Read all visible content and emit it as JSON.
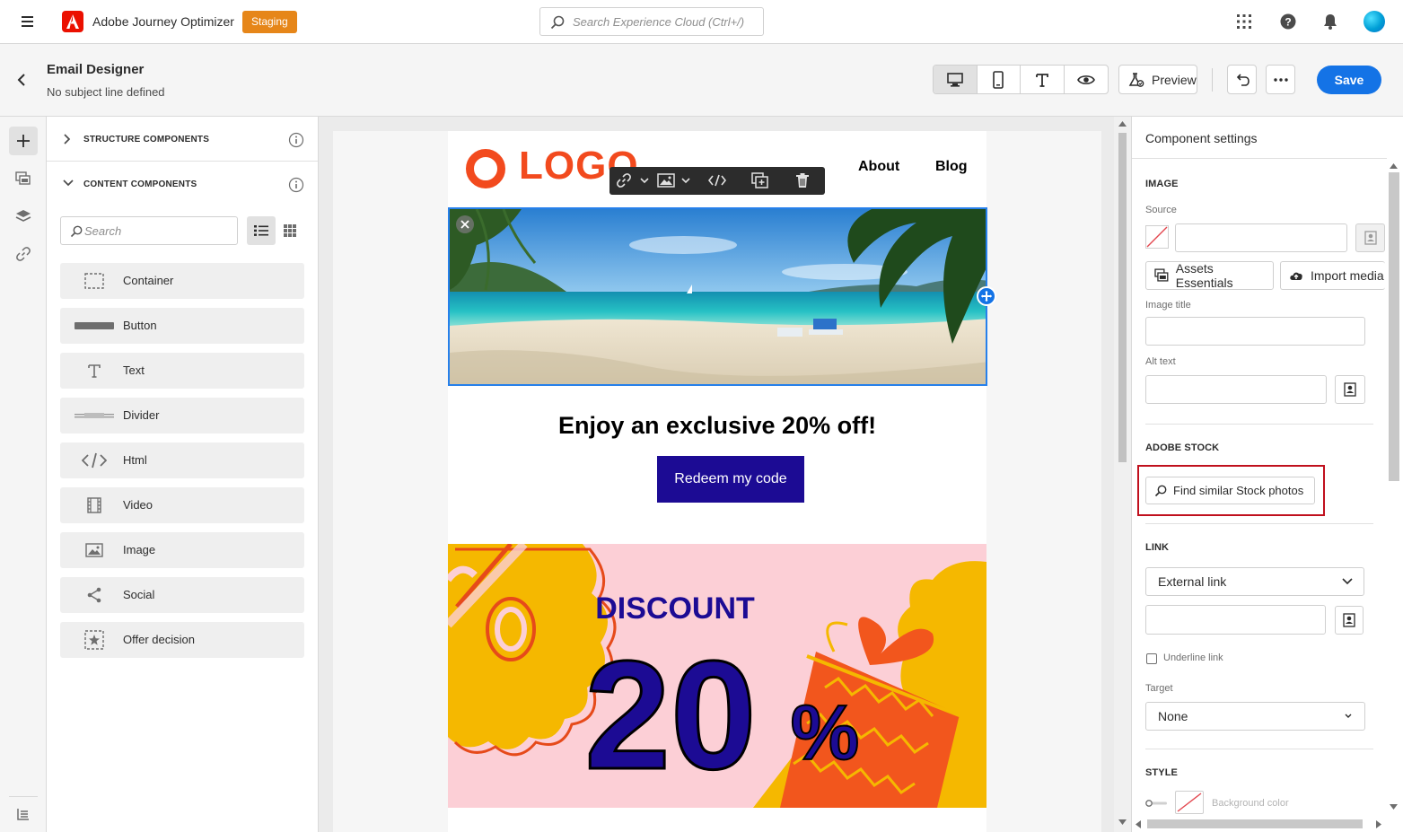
{
  "topbar": {
    "app_title": "Adobe Journey Optimizer",
    "env_badge": "Staging",
    "search_placeholder": "Search Experience Cloud (Ctrl+/)"
  },
  "header": {
    "title": "Email Designer",
    "subtitle": "No subject line defined",
    "preview_label": "Preview",
    "save_label": "Save"
  },
  "components": {
    "structure_header": "STRUCTURE COMPONENTS",
    "content_header": "CONTENT COMPONENTS",
    "search_placeholder": "Search",
    "items": [
      {
        "label": "Container",
        "icon": "container-icon"
      },
      {
        "label": "Button",
        "icon": "button-icon"
      },
      {
        "label": "Text",
        "icon": "text-icon"
      },
      {
        "label": "Divider",
        "icon": "divider-icon"
      },
      {
        "label": "Html",
        "icon": "code-icon"
      },
      {
        "label": "Video",
        "icon": "video-icon"
      },
      {
        "label": "Image",
        "icon": "image-icon"
      },
      {
        "label": "Social",
        "icon": "share-icon"
      },
      {
        "label": "Offer decision",
        "icon": "offer-decision-icon"
      }
    ]
  },
  "email": {
    "logo_text": "LOGO",
    "nav": [
      "About",
      "Blog"
    ],
    "headline": "Enjoy an exclusive 20% off!",
    "cta": "Redeem my code",
    "promo_title": "DISCOUNT",
    "promo_number": "20",
    "promo_percent": "%"
  },
  "settings": {
    "title": "Component settings",
    "image_section": "IMAGE",
    "source_label": "Source",
    "assets_button": "Assets Essentials",
    "import_button": "Import media",
    "image_title_label": "Image title",
    "alt_text_label": "Alt text",
    "stock_section": "ADOBE STOCK",
    "stock_button": "Find similar Stock photos",
    "link_section": "LINK",
    "link_type": "External link",
    "underline_label": "Underline link",
    "target_label": "Target",
    "target_value": "None",
    "style_section": "STYLE",
    "bg_color_label": "Background color"
  },
  "colors": {
    "accent": "#1473e6",
    "staging": "#e68619",
    "logo": "#f24a1e",
    "cta": "#1c0b94",
    "highlight": "#c0101d"
  }
}
